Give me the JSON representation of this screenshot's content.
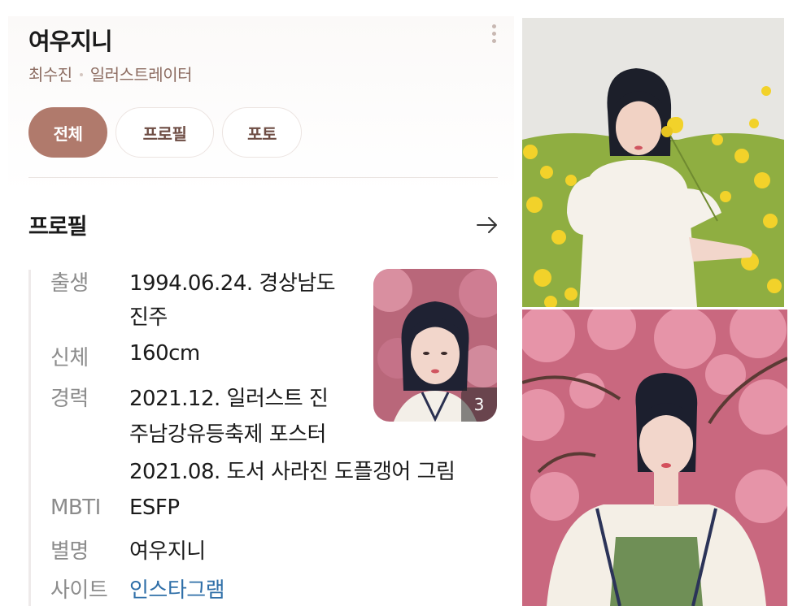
{
  "profile": {
    "name": "여우지니",
    "real_name": "최수진",
    "job": "일러스트레이터"
  },
  "tabs": [
    {
      "label": "전체",
      "active": true
    },
    {
      "label": "프로필",
      "active": false
    },
    {
      "label": "포토",
      "active": false
    }
  ],
  "section": {
    "title": "프로필"
  },
  "info": {
    "birth_label": "출생",
    "birth_value_line1": "1994.06.24. 경상남도",
    "birth_value_line2": "진주",
    "body_label": "신체",
    "body_value": "160cm",
    "career_label": "경력",
    "career_line1": "2021.12. 일러스트 진",
    "career_line2": "주남강유등축제 포스터",
    "career_line3": "2021.08. 도서 사라진 도플갱어 그림",
    "mbti_label": "MBTI",
    "mbti_value": "ESFP",
    "alias_label": "별명",
    "alias_value": "여우지니",
    "site_label": "사이트",
    "site_value": "인스타그램"
  },
  "thumbnail": {
    "count": "3"
  },
  "icons": {
    "more": "more-vertical-icon",
    "arrow": "arrow-right-icon"
  },
  "colors": {
    "accent": "#b07a6c",
    "subtitle": "#8d6d62",
    "link": "#2f6fa8"
  }
}
